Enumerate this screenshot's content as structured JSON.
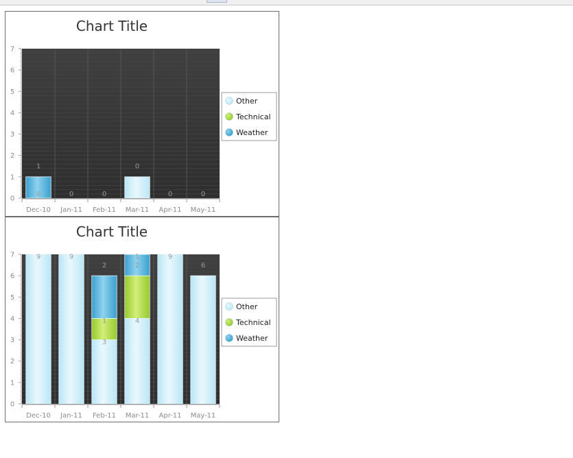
{
  "colors": {
    "plot_background": "#3a3a3a",
    "other": "#c6ecf8",
    "technical": "#a6d63c",
    "weather": "#3fa6d6"
  },
  "chart_data": [
    {
      "type": "bar",
      "stacked": true,
      "title": "Chart Title",
      "categories": [
        "Dec-10",
        "Jan-11",
        "Feb-11",
        "Mar-11",
        "Apr-11",
        "May-11"
      ],
      "ylim": [
        0,
        7
      ],
      "yticks": [
        "0",
        "1",
        "2",
        "3",
        "4",
        "5",
        "6",
        "7"
      ],
      "grid": true,
      "legend_position": "right",
      "series": [
        {
          "name": "Other",
          "color": "#c6ecf8",
          "values": [
            0,
            0,
            0,
            1,
            0,
            0
          ]
        },
        {
          "name": "Technical",
          "color": "#a6d63c",
          "values": [
            0,
            0,
            0,
            0,
            0,
            0
          ]
        },
        {
          "name": "Weather",
          "color": "#3fa6d6",
          "values": [
            1,
            0,
            0,
            0,
            0,
            0
          ]
        }
      ],
      "data_labels": [
        {
          "category": 0,
          "y": 0,
          "text": "0"
        },
        {
          "category": 0,
          "y": 1.3,
          "text": "1"
        },
        {
          "category": 1,
          "y": 0,
          "text": "0"
        },
        {
          "category": 2,
          "y": 0,
          "text": "0"
        },
        {
          "category": 3,
          "y": 1.3,
          "text": "0"
        },
        {
          "category": 4,
          "y": 0,
          "text": "0"
        },
        {
          "category": 5,
          "y": 0,
          "text": "0"
        }
      ]
    },
    {
      "type": "bar",
      "stacked": true,
      "title": "Chart Title",
      "categories": [
        "Dec-10",
        "Jan-11",
        "Feb-11",
        "Mar-11",
        "Apr-11",
        "May-11"
      ],
      "ylim": [
        0,
        7
      ],
      "yticks": [
        "0",
        "1",
        "2",
        "3",
        "4",
        "5",
        "6",
        "7"
      ],
      "grid": true,
      "legend_position": "right",
      "series": [
        {
          "name": "Other",
          "color": "#c6ecf8",
          "values": [
            9,
            9,
            3,
            4,
            9,
            6
          ]
        },
        {
          "name": "Technical",
          "color": "#a6d63c",
          "values": [
            0,
            0,
            1,
            2,
            0,
            0
          ]
        },
        {
          "name": "Weather",
          "color": "#3fa6d6",
          "values": [
            0,
            0,
            2,
            1,
            0,
            0
          ]
        }
      ],
      "data_labels": [
        {
          "category": 0,
          "y": 6.7,
          "text": "9"
        },
        {
          "category": 1,
          "y": 6.7,
          "text": "9"
        },
        {
          "category": 2,
          "y": 2.7,
          "text": "3"
        },
        {
          "category": 2,
          "y": 3.7,
          "text": "1"
        },
        {
          "category": 2,
          "y": 6.3,
          "text": "2"
        },
        {
          "category": 3,
          "y": 3.7,
          "text": "4"
        },
        {
          "category": 3,
          "y": 6.3,
          "text": "2"
        },
        {
          "category": 3,
          "y": 6.7,
          "text": "1"
        },
        {
          "category": 4,
          "y": 6.7,
          "text": "9"
        },
        {
          "category": 5,
          "y": 6.3,
          "text": "6"
        }
      ]
    }
  ]
}
